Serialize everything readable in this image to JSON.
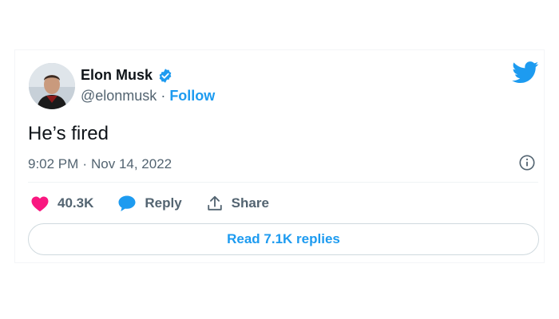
{
  "author": {
    "display_name": "Elon Musk",
    "handle": "@elonmusk",
    "separator": "·",
    "follow_label": "Follow",
    "verified_color": "#1d9bf0"
  },
  "tweet": {
    "text": "He’s fired",
    "time": "9:02 PM",
    "separator": "·",
    "date": "Nov 14, 2022"
  },
  "actions": {
    "likes": "40.3K",
    "reply_label": "Reply",
    "share_label": "Share"
  },
  "replies_button": {
    "label": "Read 7.1K replies"
  },
  "icons": {
    "brand": "twitter-bird-icon",
    "info": "info-icon",
    "like": "heart-icon",
    "reply": "speech-bubble-icon",
    "share": "share-upload-icon"
  },
  "colors": {
    "accent": "#1d9bf0",
    "like": "#f91880",
    "muted": "#536471",
    "text": "#0f1419",
    "border": "#cfd9de"
  }
}
